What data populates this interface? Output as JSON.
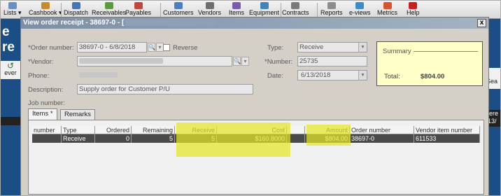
{
  "toolbar": [
    {
      "label": "Lists",
      "icon": "lists-icon",
      "color": "#6a8fc2",
      "menu": true
    },
    {
      "label": "Cashbook",
      "icon": "cashbook-icon",
      "color": "#c98a2e",
      "menu": true
    },
    {
      "label": "Dispatch",
      "icon": "dispatch-icon",
      "color": "#4a73b6"
    },
    {
      "label": "Receivables",
      "icon": "receivables-icon",
      "color": "#5c9a3e"
    },
    {
      "label": "Payables",
      "icon": "payables-icon",
      "color": "#c2443a"
    },
    {
      "label": "Customers",
      "icon": "customers-icon",
      "color": "#4b7fc2"
    },
    {
      "label": "Vendors",
      "icon": "vendors-icon",
      "color": "#6e6e6e"
    },
    {
      "label": "Items",
      "icon": "items-icon",
      "color": "#7a5ab0"
    },
    {
      "label": "Equipment",
      "icon": "equipment-icon",
      "color": "#3f85b8"
    },
    {
      "label": "Contracts",
      "icon": "contracts-icon",
      "color": "#7a7a7a"
    },
    {
      "label": "Reports",
      "icon": "reports-icon",
      "color": "#8c8c8c"
    },
    {
      "label": "e-views",
      "icon": "eviews-icon",
      "color": "#3c8cc8"
    },
    {
      "label": "Metrics",
      "icon": "metrics-icon",
      "color": "#d6542e"
    },
    {
      "label": "Help",
      "icon": "help-icon",
      "color": "#c81e1e"
    }
  ],
  "background": {
    "left_title": "e re",
    "left_button": "ever",
    "right_button": "Sea",
    "right_labels": [
      "iere",
      "13/"
    ]
  },
  "dialog": {
    "title": "View order receipt - 38697-0 - [",
    "close": "x",
    "order_number_label": "*Order number:",
    "order_number_value": "38697-0 - 6/8/2018",
    "reverse_label": "Reverse",
    "vendor_label": "*Vendor:",
    "phone_label": "Phone:",
    "description_label": "Description:",
    "description_value": "Supply order for Customer P/U",
    "job_number_label": "Job number:",
    "type_label": "Type:",
    "type_value": "Receive",
    "number_label": "*Number:",
    "number_value": "25735",
    "date_label": "Date:",
    "date_value": "6/13/2018",
    "summary_title": "Summary",
    "total_label": "Total:",
    "total_value": "$804.00",
    "highlight_color": "#e6e628"
  },
  "tabs": [
    {
      "label": "Items *",
      "active": true
    },
    {
      "label": "Remarks",
      "active": false
    }
  ],
  "grid": {
    "columns": [
      "number",
      "Type",
      "Ordered",
      "Remaining",
      "Receive",
      "Cost",
      "",
      "Amount",
      "Order number",
      "Vendor item number"
    ],
    "rows": [
      [
        "",
        "Receive",
        "0",
        "5",
        "5",
        "$160.8000",
        "",
        "$804.00",
        "38697-0",
        "611533"
      ]
    ]
  }
}
